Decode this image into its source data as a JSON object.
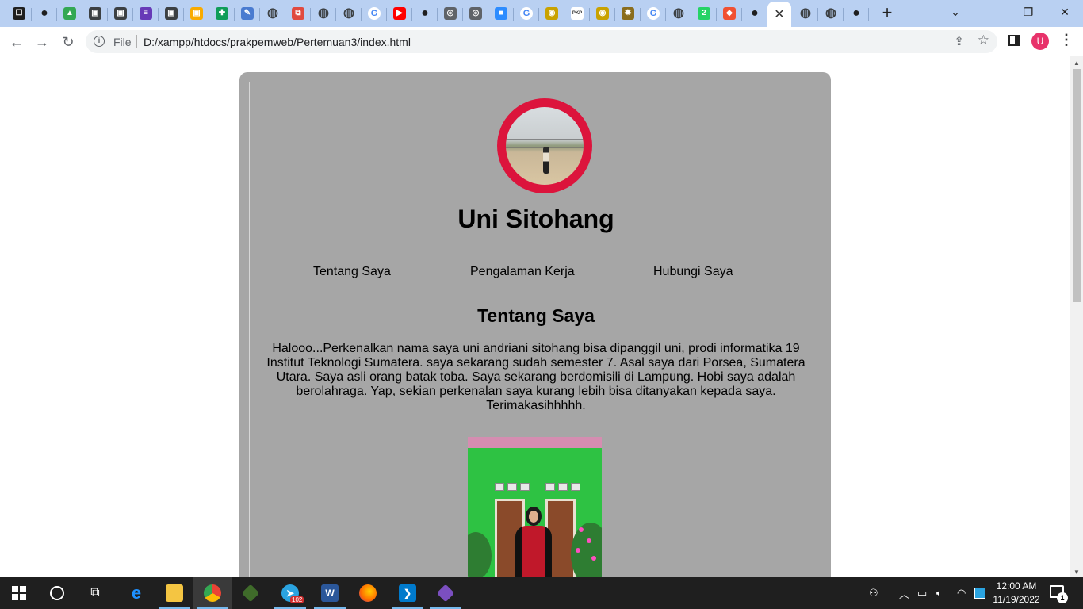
{
  "browser": {
    "tabs": [
      {
        "icon": "tab-search-icon",
        "color": "#1f1f1f",
        "glyph": "☐"
      },
      {
        "icon": "github-icon",
        "color": "#1f1f1f",
        "glyph": "●"
      },
      {
        "icon": "google-drive-icon",
        "color": "#34a853",
        "glyph": "▲"
      },
      {
        "icon": "classroom-icon",
        "color": "#3c4043",
        "glyph": "▣"
      },
      {
        "icon": "classroom-icon",
        "color": "#3c4043",
        "glyph": "▣"
      },
      {
        "icon": "google-forms-icon",
        "color": "#673ab7",
        "glyph": "≡"
      },
      {
        "icon": "classroom-icon",
        "color": "#3c4043",
        "glyph": "▣"
      },
      {
        "icon": "google-classroom-icon",
        "color": "#f9ab00",
        "glyph": "▣"
      },
      {
        "icon": "google-sheets-icon",
        "color": "#0f9d58",
        "glyph": "✚"
      },
      {
        "icon": "document-icon",
        "color": "#4a7bd0",
        "glyph": "✎"
      },
      {
        "icon": "globe-icon",
        "color": "#3c4043",
        "glyph": "◍"
      },
      {
        "icon": "pdf-icon",
        "color": "#e04a3f",
        "glyph": "⧉"
      },
      {
        "icon": "globe-icon",
        "color": "#3c4043",
        "glyph": "◍"
      },
      {
        "icon": "globe-icon",
        "color": "#3c4043",
        "glyph": "◍"
      },
      {
        "icon": "google-icon",
        "color": "#4285f4",
        "glyph": "G"
      },
      {
        "icon": "youtube-icon",
        "color": "#ff0000",
        "glyph": "▶"
      },
      {
        "icon": "github-icon",
        "color": "#1f1f1f",
        "glyph": "●"
      },
      {
        "icon": "chrome-icon",
        "color": "#5f6368",
        "glyph": "◎"
      },
      {
        "icon": "chrome-icon",
        "color": "#5f6368",
        "glyph": "◎"
      },
      {
        "icon": "zoom-icon",
        "color": "#2d8cff",
        "glyph": "■"
      },
      {
        "icon": "google-icon",
        "color": "#4285f4",
        "glyph": "G"
      },
      {
        "icon": "university-icon",
        "color": "#c9a200",
        "glyph": "◉"
      },
      {
        "icon": "pkp-icon",
        "color": "#ffffff",
        "glyph": "PKP"
      },
      {
        "icon": "university-icon",
        "color": "#c9a200",
        "glyph": "◉"
      },
      {
        "icon": "emblem-icon",
        "color": "#8a6d1e",
        "glyph": "✹"
      },
      {
        "icon": "google-icon",
        "color": "#4285f4",
        "glyph": "G"
      },
      {
        "icon": "globe-icon",
        "color": "#3c4043",
        "glyph": "◍"
      },
      {
        "icon": "whatsapp-icon",
        "color": "#25d366",
        "glyph": "2"
      },
      {
        "icon": "git-icon",
        "color": "#f05133",
        "glyph": "◆"
      },
      {
        "icon": "github-icon",
        "color": "#1f1f1f",
        "glyph": "●"
      }
    ],
    "tabs_after": [
      {
        "icon": "globe-icon",
        "color": "#3c4043",
        "glyph": "◍"
      },
      {
        "icon": "globe-icon",
        "color": "#3c4043",
        "glyph": "◍"
      },
      {
        "icon": "github-icon",
        "color": "#1f1f1f",
        "glyph": "●"
      }
    ],
    "active_tab_close": "✕",
    "new_tab_label": "+",
    "address": {
      "scheme": "File",
      "url": "D:/xampp/htdocs/prakpemweb/Pertemuan3/index.html"
    },
    "profile_initial": "U"
  },
  "page": {
    "name": "Uni Sitohang",
    "nav": [
      "Tentang Saya",
      "Pengalaman Kerja",
      "Hubungi Saya"
    ],
    "section_title": "Tentang Saya",
    "about": "Halooo...Perkenalkan nama saya uni andriani sitohang bisa dipanggil uni, prodi informatika 19 Institut Teknologi Sumatera. saya sekarang sudah semester 7. Asal saya dari Porsea, Sumatera Utara. Saya asli orang batak toba. Saya sekarang berdomisili di Lampung. Hobi saya adalah berolahraga. Yap, sekian perkenalan saya kurang lebih bisa ditanyakan kepada saya. Terimakasihhhhh.",
    "colors": {
      "card": "#a6a6a6",
      "profile_ring": "#dc143c"
    }
  },
  "taskbar": {
    "apps": [
      {
        "icon": "windows-start-icon"
      },
      {
        "icon": "cortana-search-icon"
      },
      {
        "icon": "task-view-icon"
      },
      {
        "icon": "edge-icon"
      },
      {
        "icon": "file-explorer-icon"
      },
      {
        "icon": "chrome-icon"
      },
      {
        "icon": "app-icon"
      },
      {
        "icon": "telegram-icon",
        "badge": "102"
      },
      {
        "icon": "word-icon"
      },
      {
        "icon": "firefox-icon"
      },
      {
        "icon": "vscode-icon"
      },
      {
        "icon": "git-kraken-icon"
      }
    ],
    "clock": {
      "time": "12:00 AM",
      "date": "11/19/2022"
    },
    "notification_count": "1"
  }
}
